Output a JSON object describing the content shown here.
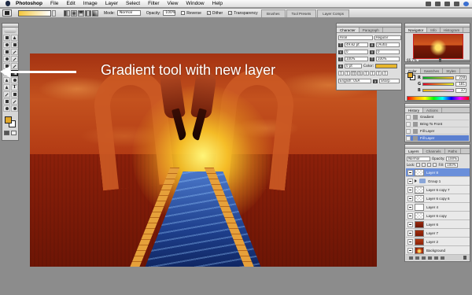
{
  "menubar": {
    "items": [
      "Photoshop",
      "File",
      "Edit",
      "Image",
      "Layer",
      "Select",
      "Filter",
      "View",
      "Window",
      "Help"
    ],
    "status_icons": [
      "wifi-icon",
      "volume-icon",
      "battery-icon",
      "clock-icon",
      "spotlight-icon"
    ]
  },
  "options_bar": {
    "mode_label": "Mode:",
    "mode_value": "Normal",
    "opacity_label": "Opacity:",
    "opacity_value": "100%",
    "reverse_label": "Reverse",
    "dither_label": "Dither",
    "transparency_label": "Transparency",
    "gradient_colors": [
      "#f4c73c",
      "#ffffff"
    ],
    "well_tabs": [
      "Brushes",
      "Tool Presets",
      "Layer Comps"
    ]
  },
  "foreground_color": "#e2a82a",
  "background_color": "#ffffff",
  "annotation": {
    "text": "Gradient tool with new layer"
  },
  "character_panel": {
    "tabs": [
      "Character",
      "Paragraph"
    ],
    "font_family": "Arial",
    "font_style": "Regular",
    "font_size": "49.82 pt",
    "leading": "(Auto)",
    "tracking_a": "0",
    "tracking_b": "0",
    "scale_v": "100%",
    "scale_h": "100%",
    "baseline": "0 pt",
    "color_label": "Color:",
    "language": "English: USA",
    "antialias": "Sharp",
    "style_buttons": [
      "T",
      "T",
      "TT",
      "Tt",
      "T",
      "T",
      "T",
      "T"
    ]
  },
  "navigator_panel": {
    "tabs": [
      "Navigator",
      "Info",
      "Histogram"
    ],
    "zoom": "66.7%"
  },
  "color_panel": {
    "tabs": [
      "Color",
      "Swatches",
      "Styles"
    ],
    "r_label": "R",
    "g_label": "G",
    "b_label": "B",
    "r_value": "228",
    "g_value": "181",
    "b_value": "37"
  },
  "history_panel": {
    "tabs": [
      "History",
      "Actions"
    ],
    "items": [
      "Gradient",
      "Bring To Front",
      "Fill Layer",
      "Fill Layer"
    ],
    "selected_index": 3
  },
  "layers_panel": {
    "tabs": [
      "Layers",
      "Channels",
      "Paths"
    ],
    "blend_mode": "Normal",
    "opacity_label": "Opacity:",
    "opacity_value": "100%",
    "lock_label": "Lock:",
    "fill_label": "Fill:",
    "fill_value": "100%",
    "layers": [
      {
        "name": "Layer 8",
        "selected": true,
        "type": "layer"
      },
      {
        "name": "Group 1",
        "selected": false,
        "type": "group"
      },
      {
        "name": "Layer 6 copy 7",
        "selected": false,
        "type": "layer"
      },
      {
        "name": "Layer 6 copy 6",
        "selected": false,
        "type": "layer"
      },
      {
        "name": "Layer 4",
        "selected": false,
        "type": "layer"
      },
      {
        "name": "Layer 6 copy",
        "selected": false,
        "type": "layer"
      },
      {
        "name": "Layer 6",
        "selected": false,
        "type": "layer"
      },
      {
        "name": "Layer 7",
        "selected": false,
        "type": "layer"
      },
      {
        "name": "Layer 2",
        "selected": false,
        "type": "layer"
      },
      {
        "name": "Background",
        "selected": false,
        "type": "layer"
      }
    ]
  }
}
